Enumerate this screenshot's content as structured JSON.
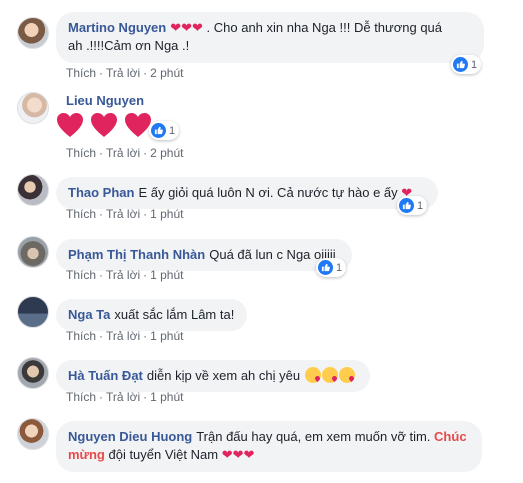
{
  "actions": {
    "like": "Thích",
    "reply": "Trả lời",
    "dot": "·"
  },
  "comments": [
    {
      "name": "Martino Nguyen",
      "text_a": " . Cho anh xin nha Nga !!! Dễ thương quá",
      "text_b": "ah .!!!!Cảm ơn Nga .!",
      "time": "2 phút",
      "reactions": "1"
    },
    {
      "name": "Lieu Nguyen",
      "time": "2 phút",
      "reactions": "1"
    },
    {
      "name": "Thao Phan",
      "text": "E ấy giỏi quá luôn N ơi. Cả nước tự hào e ấy",
      "time": "1 phút",
      "reactions": "1"
    },
    {
      "name": "Phạm Thị Thanh Nhàn",
      "text": "Quá đã lun c Nga oiiiii",
      "time": "1 phút",
      "reactions": "1"
    },
    {
      "name": "Nga Ta",
      "text": "xuất sắc lắm Lâm ta!",
      "time": "1 phút"
    },
    {
      "name": "Hà Tuấn Đạt",
      "text": "diễn kịp về xem ah chị yêu",
      "time": "1 phút"
    },
    {
      "name": "Nguyen Dieu Huong",
      "text_a": "Trận đấu hay quá, em xem muốn vỡ tim.",
      "highlight_a": "Chúc",
      "highlight_b": "mừng",
      "text_b": "đội tuyển Việt Nam"
    }
  ],
  "colors": {
    "name": "#385898",
    "bubble": "#f2f3f5",
    "heart": "#e0245e",
    "like": "#2078f4",
    "highlight": "#e64a4a"
  }
}
